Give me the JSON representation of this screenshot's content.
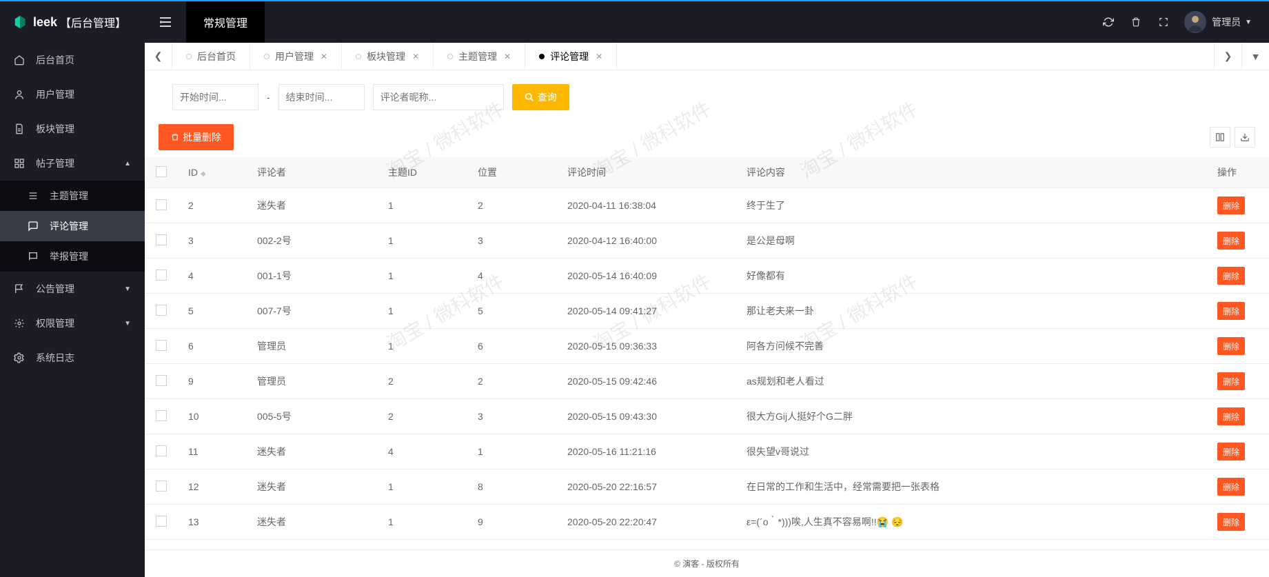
{
  "brand": {
    "name": "leek",
    "suffix": "【后台管理】"
  },
  "header": {
    "top_tab": "常规管理",
    "username": "管理员"
  },
  "sidebar": {
    "items": [
      {
        "label": "后台首页",
        "icon": "home"
      },
      {
        "label": "用户管理",
        "icon": "user"
      },
      {
        "label": "板块管理",
        "icon": "doc"
      },
      {
        "label": "帖子管理",
        "icon": "grid",
        "expanded": true,
        "children": [
          {
            "label": "主题管理",
            "icon": "list"
          },
          {
            "label": "评论管理",
            "icon": "chat",
            "active": true
          },
          {
            "label": "举报管理",
            "icon": "flag"
          }
        ]
      },
      {
        "label": "公告管理",
        "icon": "flag2"
      },
      {
        "label": "权限管理",
        "icon": "gear"
      },
      {
        "label": "系统日志",
        "icon": "gear2"
      }
    ]
  },
  "tabs": [
    {
      "label": "后台首页",
      "closable": false
    },
    {
      "label": "用户管理",
      "closable": true
    },
    {
      "label": "板块管理",
      "closable": true
    },
    {
      "label": "主题管理",
      "closable": true
    },
    {
      "label": "评论管理",
      "closable": true,
      "active": true
    }
  ],
  "filter": {
    "start_placeholder": "开始时间...",
    "end_placeholder": "结束时间...",
    "nick_placeholder": "评论者昵称...",
    "search_label": "查询"
  },
  "toolbar": {
    "batch_delete": "批量删除"
  },
  "table": {
    "headers": {
      "id": "ID",
      "author": "评论者",
      "topic_id": "主题ID",
      "pos": "位置",
      "time": "评论时间",
      "content": "评论内容",
      "op": "操作"
    },
    "delete_label": "删除",
    "rows": [
      {
        "id": "2",
        "author": "迷失者",
        "topic_id": "1",
        "pos": "2",
        "time": "2020-04-11 16:38:04",
        "content": "终于生了"
      },
      {
        "id": "3",
        "author": "002-2号",
        "topic_id": "1",
        "pos": "3",
        "time": "2020-04-12 16:40:00",
        "content": "是公是母啊"
      },
      {
        "id": "4",
        "author": "001-1号",
        "topic_id": "1",
        "pos": "4",
        "time": "2020-05-14 16:40:09",
        "content": "好像都有"
      },
      {
        "id": "5",
        "author": "007-7号",
        "topic_id": "1",
        "pos": "5",
        "time": "2020-05-14 09:41:27",
        "content": "那让老夫来一卦"
      },
      {
        "id": "6",
        "author": "管理员",
        "topic_id": "1",
        "pos": "6",
        "time": "2020-05-15 09:36:33",
        "content": "阿各方问候不完善"
      },
      {
        "id": "9",
        "author": "管理员",
        "topic_id": "2",
        "pos": "2",
        "time": "2020-05-15 09:42:46",
        "content": "as规划和老人看过"
      },
      {
        "id": "10",
        "author": "005-5号",
        "topic_id": "2",
        "pos": "3",
        "time": "2020-05-15 09:43:30",
        "content": "很大方Gij人挺好个G二胖"
      },
      {
        "id": "11",
        "author": "迷失者",
        "topic_id": "4",
        "pos": "1",
        "time": "2020-05-16 11:21:16",
        "content": "很失望v哥说过"
      },
      {
        "id": "12",
        "author": "迷失者",
        "topic_id": "1",
        "pos": "8",
        "time": "2020-05-20 22:16:57",
        "content": "在日常的工作和生活中，经常需要把一张表格"
      },
      {
        "id": "13",
        "author": "迷失者",
        "topic_id": "1",
        "pos": "9",
        "time": "2020-05-20 22:20:47",
        "content": "ε=(´ο｀*)))唉,人生真不容易啊!!😭 😔"
      }
    ]
  },
  "footer": "© 演客 - 版权所有",
  "watermark": "淘宝 / 微科软件"
}
